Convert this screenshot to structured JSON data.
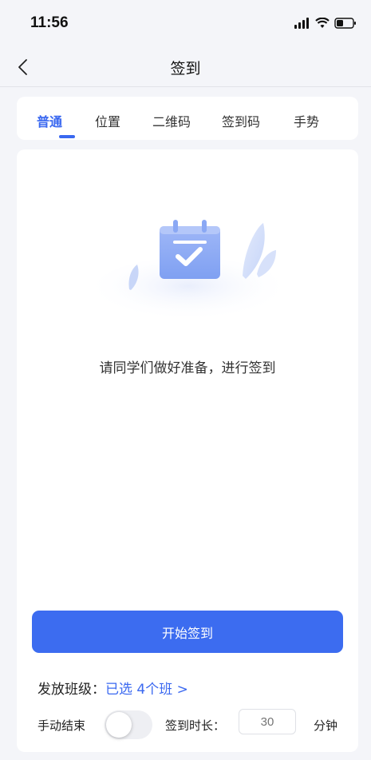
{
  "status": {
    "time": "11:56"
  },
  "nav": {
    "title": "签到"
  },
  "tabs": [
    {
      "label": "普通",
      "active": true
    },
    {
      "label": "位置",
      "active": false
    },
    {
      "label": "二维码",
      "active": false
    },
    {
      "label": "签到码",
      "active": false
    },
    {
      "label": "手势",
      "active": false
    }
  ],
  "main": {
    "prompt": "请同学们做好准备，进行签到",
    "start_button": "开始签到",
    "class_label": "发放班级：",
    "class_value": "已选 4个班 >",
    "manual_end_label": "手动结束",
    "manual_end_on": false,
    "duration_label": "签到时长：",
    "duration_placeholder": "30",
    "duration_unit": "分钟"
  },
  "colors": {
    "accent": "#3a68f0",
    "background": "#f4f5f9"
  }
}
